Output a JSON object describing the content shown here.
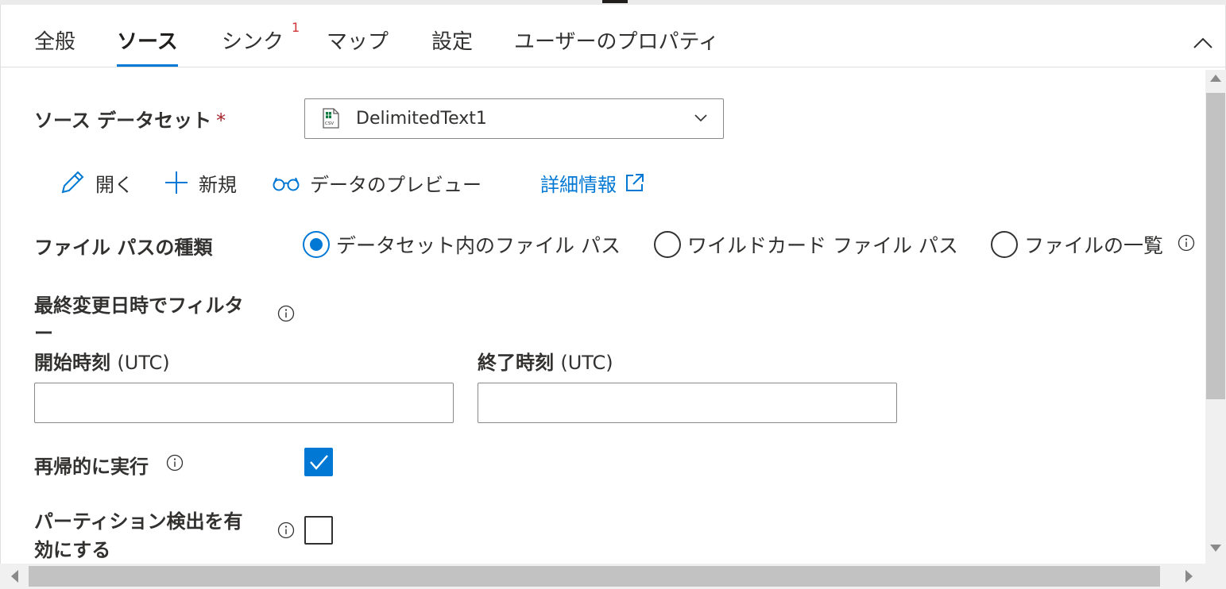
{
  "tabs": [
    {
      "label": "全般"
    },
    {
      "label": "ソース"
    },
    {
      "label": "シンク",
      "badge": "1"
    },
    {
      "label": "マップ"
    },
    {
      "label": "設定"
    },
    {
      "label": "ユーザーのプロパティ"
    }
  ],
  "source_dataset": {
    "label": "ソース データセット",
    "required_mark": "*",
    "value": "DelimitedText1",
    "icon": "csv-file-icon"
  },
  "actions": {
    "open": "開く",
    "new": "新規",
    "preview": "データのプレビュー",
    "learn_more": "詳細情報"
  },
  "file_path_type": {
    "label": "ファイル パスの種類",
    "options": [
      {
        "label": "データセット内のファイル パス",
        "selected": true
      },
      {
        "label": "ワイルドカード ファイル パス",
        "selected": false
      },
      {
        "label": "ファイルの一覧",
        "selected": false
      }
    ]
  },
  "filter_by_last_modified": {
    "label_line1": "最終変更日時でフィルタ",
    "label_line2": "ー"
  },
  "start_time": {
    "label": "開始時刻",
    "unit": "(UTC)",
    "value": ""
  },
  "end_time": {
    "label": "終了時刻",
    "unit": "(UTC)",
    "value": ""
  },
  "recursive": {
    "label": "再帰的に実行",
    "checked": true
  },
  "partition_discovery": {
    "label_line1": "パーティション検出を有",
    "label_line2": "効にする",
    "checked": false
  },
  "colors": {
    "accent": "#0078d4",
    "badge": "#d13438",
    "required": "#a4262c"
  }
}
